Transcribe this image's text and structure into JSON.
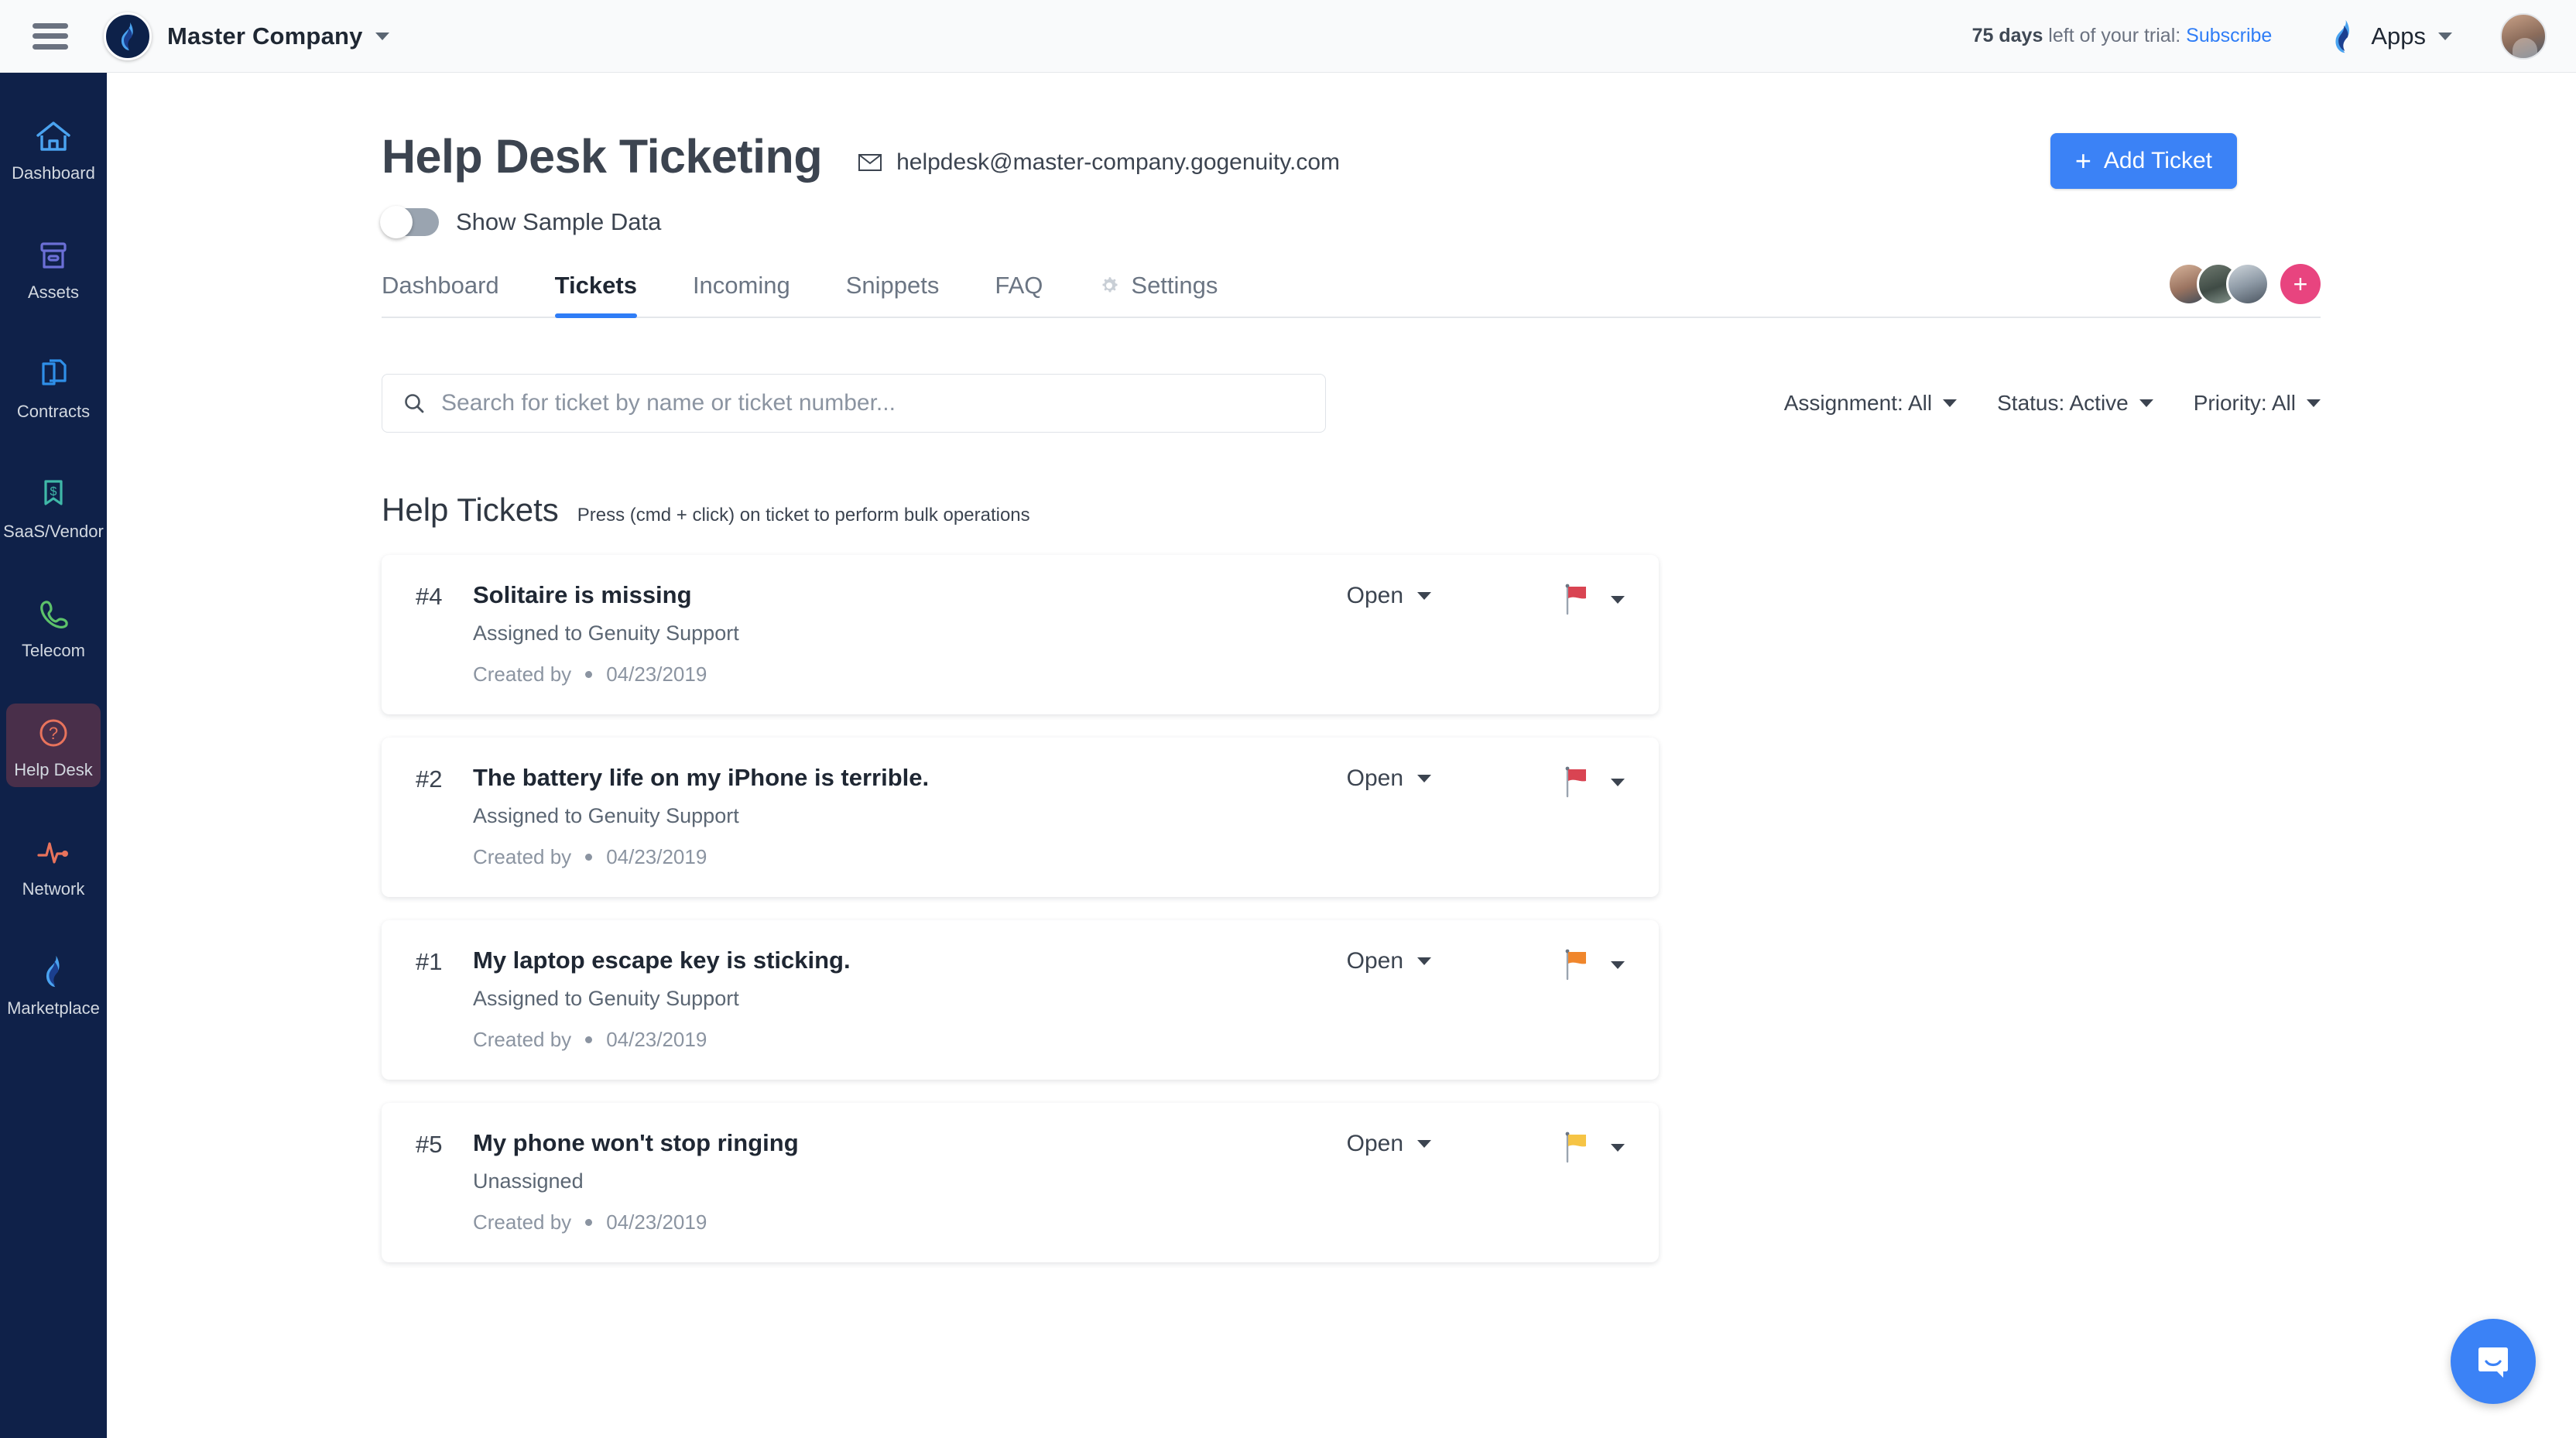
{
  "topbar": {
    "menu_icon": "hamburger-icon",
    "company_name": "Master Company",
    "trial_days": "75 days",
    "trial_text": " left of your trial: ",
    "trial_link": "Subscribe",
    "apps_label": "Apps"
  },
  "sidebar": {
    "items": [
      {
        "label": "Dashboard",
        "icon": "home-icon",
        "color": "#4aa3f0",
        "active": false
      },
      {
        "label": "Assets",
        "icon": "box-icon",
        "color": "#6b6fd6",
        "active": false
      },
      {
        "label": "Contracts",
        "icon": "documents-icon",
        "color": "#2f8fe8",
        "active": false
      },
      {
        "label": "SaaS/Vendor",
        "icon": "dollar-tag-icon",
        "color": "#3fb8a8",
        "active": false
      },
      {
        "label": "Telecom",
        "icon": "phone-icon",
        "color": "#5cc26a",
        "active": false
      },
      {
        "label": "Help Desk",
        "icon": "question-icon",
        "color": "#e8735c",
        "active": true
      },
      {
        "label": "Network",
        "icon": "pulse-icon",
        "color": "#e8735c",
        "active": false
      },
      {
        "label": "Marketplace",
        "icon": "flame-icon",
        "color": "#3b82f6",
        "active": false
      }
    ]
  },
  "page": {
    "title": "Help Desk Ticketing",
    "email": "helpdesk@master-company.gogenuity.com",
    "email_icon": "envelope-icon",
    "toggle_label": "Show Sample Data",
    "toggle_on": false,
    "add_ticket_label": "Add Ticket",
    "add_ticket_plus": "+",
    "accent_color": "#3b82f6"
  },
  "tabs": [
    {
      "label": "Dashboard",
      "active": false,
      "icon": ""
    },
    {
      "label": "Tickets",
      "active": true,
      "icon": ""
    },
    {
      "label": "Incoming",
      "active": false,
      "icon": ""
    },
    {
      "label": "Snippets",
      "active": false,
      "icon": ""
    },
    {
      "label": "FAQ",
      "active": false,
      "icon": ""
    },
    {
      "label": "Settings",
      "active": false,
      "icon": "gear-icon"
    }
  ],
  "team": {
    "add_member_label": "+",
    "add_member_color": "#e8447f",
    "member_count": 3
  },
  "search": {
    "placeholder": "Search for ticket by name or ticket number...",
    "value": "",
    "icon": "search-icon"
  },
  "filters": [
    {
      "label": "Assignment: All"
    },
    {
      "label": "Status: Active"
    },
    {
      "label": "Priority: All"
    }
  ],
  "list": {
    "title": "Help Tickets",
    "hint": "Press (cmd + click) on ticket to perform bulk operations"
  },
  "tickets": [
    {
      "number": "#4",
      "title": "Solitaire is missing",
      "assignment": "Assigned to Genuity Support",
      "created_label": "Created by",
      "created_date": "04/23/2019",
      "status": "Open",
      "flag_color": "#d94452"
    },
    {
      "number": "#2",
      "title": "The battery life on my iPhone is terrible.",
      "assignment": "Assigned to Genuity Support",
      "created_label": "Created by",
      "created_date": "04/23/2019",
      "status": "Open",
      "flag_color": "#d94452"
    },
    {
      "number": "#1",
      "title": "My laptop escape key is sticking.",
      "assignment": "Assigned to Genuity Support",
      "created_label": "Created by",
      "created_date": "04/23/2019",
      "status": "Open",
      "flag_color": "#f0862c"
    },
    {
      "number": "#5",
      "title": "My phone won't stop ringing",
      "assignment": "Unassigned",
      "created_label": "Created by",
      "created_date": "04/23/2019",
      "status": "Open",
      "flag_color": "#f6c445"
    }
  ],
  "chat": {
    "icon": "chat-bubble-icon",
    "color": "#3b82f6"
  }
}
